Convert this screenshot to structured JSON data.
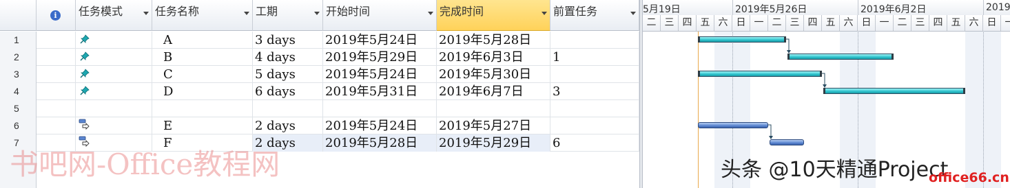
{
  "grid": {
    "headers": {
      "mode": "任务模式",
      "name": "任务名称",
      "duration": "工期",
      "start": "开始时间",
      "finish": "完成时间",
      "pred": "前置任务"
    },
    "info_icon": "i",
    "rows": [
      {
        "num": "1",
        "mode_icon": "pin-icon",
        "name": "A",
        "duration": "3 days",
        "start": "2019年5月24日",
        "finish": "2019年5月28日",
        "pred": ""
      },
      {
        "num": "2",
        "mode_icon": "pin-icon",
        "name": "B",
        "duration": "4 days",
        "start": "2019年5月29日",
        "finish": "2019年6月3日",
        "pred": "1"
      },
      {
        "num": "3",
        "mode_icon": "pin-icon",
        "name": "C",
        "duration": "5 days",
        "start": "2019年5月24日",
        "finish": "2019年5月30日",
        "pred": ""
      },
      {
        "num": "4",
        "mode_icon": "pin-icon",
        "name": "D",
        "duration": "6 days",
        "start": "2019年5月31日",
        "finish": "2019年6月7日",
        "pred": "3"
      },
      {
        "num": "5",
        "mode_icon": "",
        "name": "",
        "duration": "",
        "start": "",
        "finish": "",
        "pred": ""
      },
      {
        "num": "6",
        "mode_icon": "auto-schedule-icon",
        "name": "E",
        "duration": "2 days",
        "start": "2019年5月24日",
        "finish": "2019年5月27日",
        "pred": ""
      },
      {
        "num": "7",
        "mode_icon": "auto-schedule-icon",
        "name": "F",
        "duration": "2 days",
        "start": "2019年5月28日",
        "finish": "2019年5月29日",
        "pred": "6"
      }
    ]
  },
  "gantt": {
    "weeks": [
      "5月19日",
      "2019年5月26日",
      "2019年6月2日",
      "2019"
    ],
    "days": [
      "二",
      "三",
      "四",
      "五",
      "六",
      "日",
      "一",
      "二",
      "三",
      "四",
      "五",
      "六",
      "日",
      "一",
      "二",
      "三",
      "四",
      "五",
      "六",
      "日",
      "一"
    ]
  },
  "watermark": "书吧网-Office教程网",
  "overlay": {
    "toutiao": "头条 @10天精通Project",
    "site": "office66.cn"
  },
  "colors": {
    "manual_bar": "#2dc2cc",
    "auto_bar": "#5b86d1",
    "selected_header": "#ffd25a"
  }
}
